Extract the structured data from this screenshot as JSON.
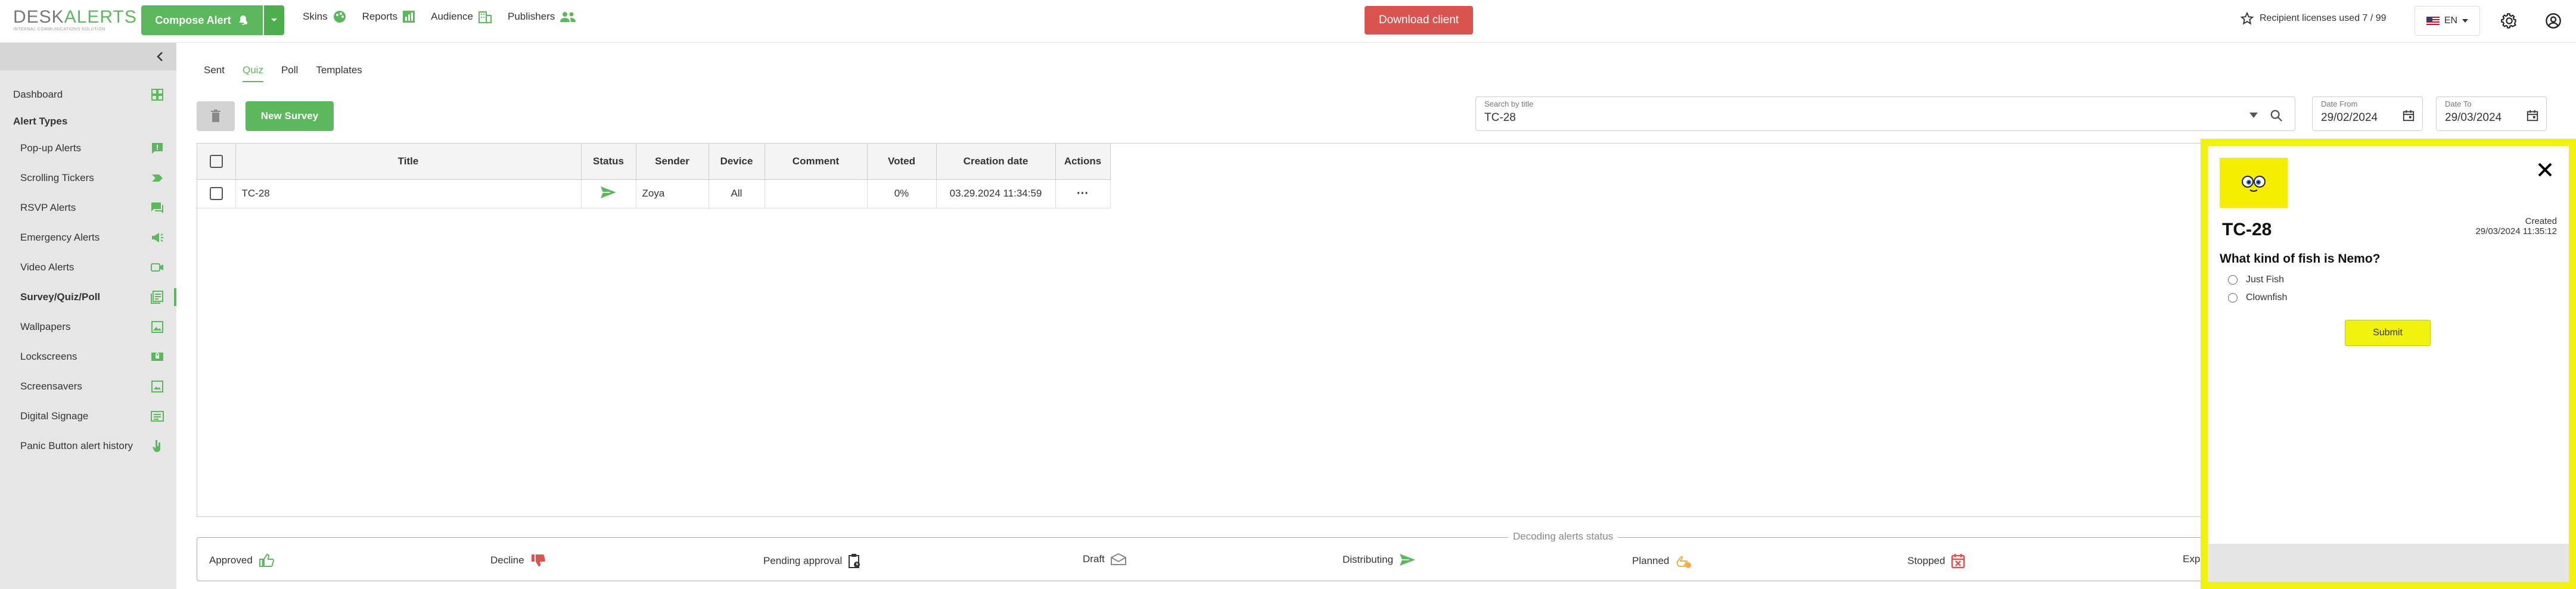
{
  "app": {
    "logo_brand_left": "DESK",
    "logo_brand_right": "ALERTS",
    "logo_tagline": "INTERNAL COMMUNICATIONS SOLUTION",
    "accent": "#5cb85c",
    "danger": "#d9534f",
    "highlight": "#f2f20f"
  },
  "topbar": {
    "compose_label": "Compose Alert",
    "nav": [
      {
        "label": "Skins",
        "icon": "palette-icon"
      },
      {
        "label": "Reports",
        "icon": "chart-icon"
      },
      {
        "label": "Audience",
        "icon": "building-icon"
      },
      {
        "label": "Publishers",
        "icon": "users-icon"
      }
    ],
    "download_label": "Download client",
    "licenses_label": "Recipient licenses used 7 / 99",
    "language": "EN"
  },
  "sidebar": {
    "dashboard": "Dashboard",
    "section_heading": "Alert Types",
    "items": [
      {
        "label": "Pop-up Alerts",
        "icon": "popup-icon"
      },
      {
        "label": "Scrolling Tickers",
        "icon": "ticker-icon"
      },
      {
        "label": "RSVP Alerts",
        "icon": "rsvp-icon"
      },
      {
        "label": "Emergency Alerts",
        "icon": "megaphone-icon"
      },
      {
        "label": "Video Alerts",
        "icon": "video-icon"
      },
      {
        "label": "Survey/Quiz/Poll",
        "icon": "survey-icon"
      },
      {
        "label": "Wallpapers",
        "icon": "wallpaper-icon"
      },
      {
        "label": "Lockscreens",
        "icon": "lockscreen-icon"
      },
      {
        "label": "Screensavers",
        "icon": "screensaver-icon"
      },
      {
        "label": "Digital Signage",
        "icon": "signage-icon"
      },
      {
        "label": "Panic Button alert history",
        "icon": "hand-icon"
      }
    ]
  },
  "main": {
    "tabs": [
      "Sent",
      "Quiz",
      "Poll",
      "Templates"
    ],
    "active_tab": "Quiz",
    "new_button": "New Survey",
    "search": {
      "label": "Search by title",
      "value": "TC-28"
    },
    "date_from": {
      "label": "Date From",
      "value": "29/02/2024"
    },
    "date_to": {
      "label": "Date To",
      "value": "29/03/2024"
    },
    "table": {
      "headers": [
        "Title",
        "Status",
        "Sender",
        "Device",
        "Comment",
        "Voted",
        "Creation date",
        "Actions"
      ],
      "rows": [
        {
          "title": "TC-28",
          "sender": "Zoya",
          "device": "All",
          "comment": "",
          "voted": "0%",
          "created": "03.29.2024 11:34:59",
          "actions": "···"
        }
      ]
    },
    "legend": {
      "title": "Decoding alerts status",
      "items": [
        "Approved",
        "Decline",
        "Pending approval",
        "Draft",
        "Distributing",
        "Planned",
        "Stopped",
        "Exp"
      ]
    }
  },
  "preview": {
    "title": "TC-28",
    "created_label": "Created",
    "created_value": "29/03/2024 11:35:12",
    "question": "What kind of fish is Nemo?",
    "options": [
      "Just Fish",
      "Clownfish"
    ],
    "submit_label": "Submit"
  }
}
